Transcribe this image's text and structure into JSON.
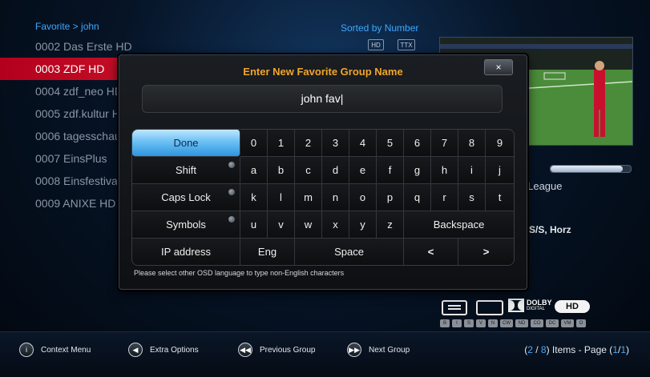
{
  "header": {
    "breadcrumb": "Favorite > john",
    "sorted_label": "Sorted by Number",
    "badge_hd": "HD",
    "badge_ttx": "TTX"
  },
  "channels": [
    {
      "label": "0002 Das Erste HD",
      "selected": false
    },
    {
      "label": "0003 ZDF HD",
      "selected": true
    },
    {
      "label": "0004 zdf_neo HD",
      "selected": false
    },
    {
      "label": "0005 zdf.kultur HD",
      "selected": false
    },
    {
      "label": "0006 tagesschau24",
      "selected": false
    },
    {
      "label": "0007 EinsPlus",
      "selected": false
    },
    {
      "label": "0008 Einsfestival",
      "selected": false
    },
    {
      "label": "0009 ANIXE HD",
      "selected": false
    }
  ],
  "info": {
    "program_text": "s League",
    "transponder_text": "XS/S, Horz",
    "progress": 0.9
  },
  "dialog": {
    "title": "Enter New Favorite Group Name",
    "close_label": "×",
    "input_value": "john fav|",
    "hint": "Please select other OSD language to type non-English characters",
    "keys": {
      "done": "Done",
      "shift": "Shift",
      "caps_lock": "Caps Lock",
      "symbols": "Symbols",
      "ip_address": "IP address",
      "eng": "Eng",
      "space": "Space",
      "backspace": "Backspace",
      "left": "<",
      "right": ">",
      "row_digits": [
        "0",
        "1",
        "2",
        "3",
        "4",
        "5",
        "6",
        "7",
        "8",
        "9"
      ],
      "row_a": [
        "a",
        "b",
        "c",
        "d",
        "e",
        "f",
        "g",
        "h",
        "i",
        "j"
      ],
      "row_k": [
        "k",
        "l",
        "m",
        "n",
        "o",
        "p",
        "q",
        "r",
        "s",
        "t"
      ],
      "row_u": [
        "u",
        "v",
        "w",
        "x",
        "y",
        "z"
      ]
    }
  },
  "codec": {
    "dolby_label": "DOLBY",
    "dolby_sub": "DIGITAL",
    "hd_label": "HD",
    "small_badges": [
      "B",
      "I",
      "S",
      "V",
      "N",
      "CW",
      "ND",
      "CO",
      "DC",
      "VM",
      "O"
    ]
  },
  "footer": {
    "context_menu": "Context Menu",
    "extra_options": "Extra Options",
    "previous_group": "Previous Group",
    "next_group": "Next Group",
    "page_open": "(",
    "items_current": "2",
    "items_sep": " / ",
    "items_total": "8",
    "items_close": ") Items - Page (",
    "page_current": "1",
    "page_sep": "/",
    "page_total": "1",
    "page_close": ")"
  },
  "colors": {
    "accent_blue": "#3da8ff",
    "selection_red": "#c8102e",
    "title_orange": "#f2a52b"
  }
}
